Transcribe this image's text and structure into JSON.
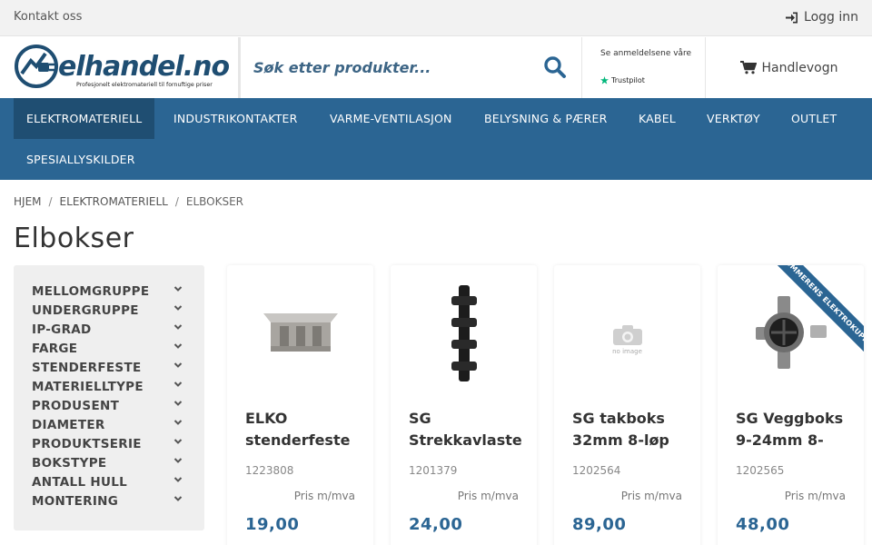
{
  "topbar": {
    "contact": "Kontakt oss",
    "login": "Logg inn"
  },
  "header": {
    "logo_text": "elhandel.no",
    "logo_tagline": "Profesjonelt elektromateriell til fornuftige priser",
    "search_placeholder": "Søk etter produkter...",
    "trust_text": "Se anmeldelsene våre",
    "trust_brand": "Trustpilot",
    "cart": "Handlevogn"
  },
  "nav": {
    "items": [
      {
        "label": "ELEKTROMATERIELL"
      },
      {
        "label": "INDUSTRIKONTAKTER"
      },
      {
        "label": "VARME-VENTILASJON"
      },
      {
        "label": "BELYSNING & PÆRER"
      },
      {
        "label": "KABEL"
      },
      {
        "label": "VERKTØY"
      },
      {
        "label": "OUTLET"
      },
      {
        "label": "SPESIALLYSKILDER"
      }
    ]
  },
  "breadcrumb": {
    "home": "HJEM",
    "category": "ELEKTROMATERIELL",
    "current": "ELBOKSER",
    "sep": "/"
  },
  "page_title": "Elbokser",
  "filters": [
    "MELLOMGRUPPE",
    "UNDERGRUPPE",
    "IP-GRAD",
    "FARGE",
    "STENDERFESTE",
    "MATERIELLTYPE",
    "PRODUSENT",
    "DIAMETER",
    "PRODUKTSERIE",
    "BOKSTYPE",
    "ANTALL HULL",
    "MONTERING"
  ],
  "products": [
    {
      "name_line1": "ELKO",
      "name_line2": "stenderfeste",
      "sku": "1223808",
      "vat": "Pris m/mva",
      "price": "19,00"
    },
    {
      "name_line1": "SG",
      "name_line2": "Strekkavlaster",
      "sku": "1201379",
      "vat": "Pris m/mva",
      "price": "24,00"
    },
    {
      "name_line1": "SG takboks",
      "name_line2": "32mm 8-løp",
      "sku": "1202564",
      "vat": "Pris m/mva",
      "price": "89,00",
      "no_image_text": "no image"
    },
    {
      "name_line1": "SG Veggboks",
      "name_line2": "9-24mm 8-",
      "sku": "1202565",
      "vat": "Pris m/mva",
      "price": "48,00",
      "ribbon": "SOMMERENS ELEKTROKUPP"
    }
  ],
  "colors": {
    "brand_blue": "#2b6593",
    "nav_active": "#1f4e72",
    "filter_bg": "#efefef"
  }
}
